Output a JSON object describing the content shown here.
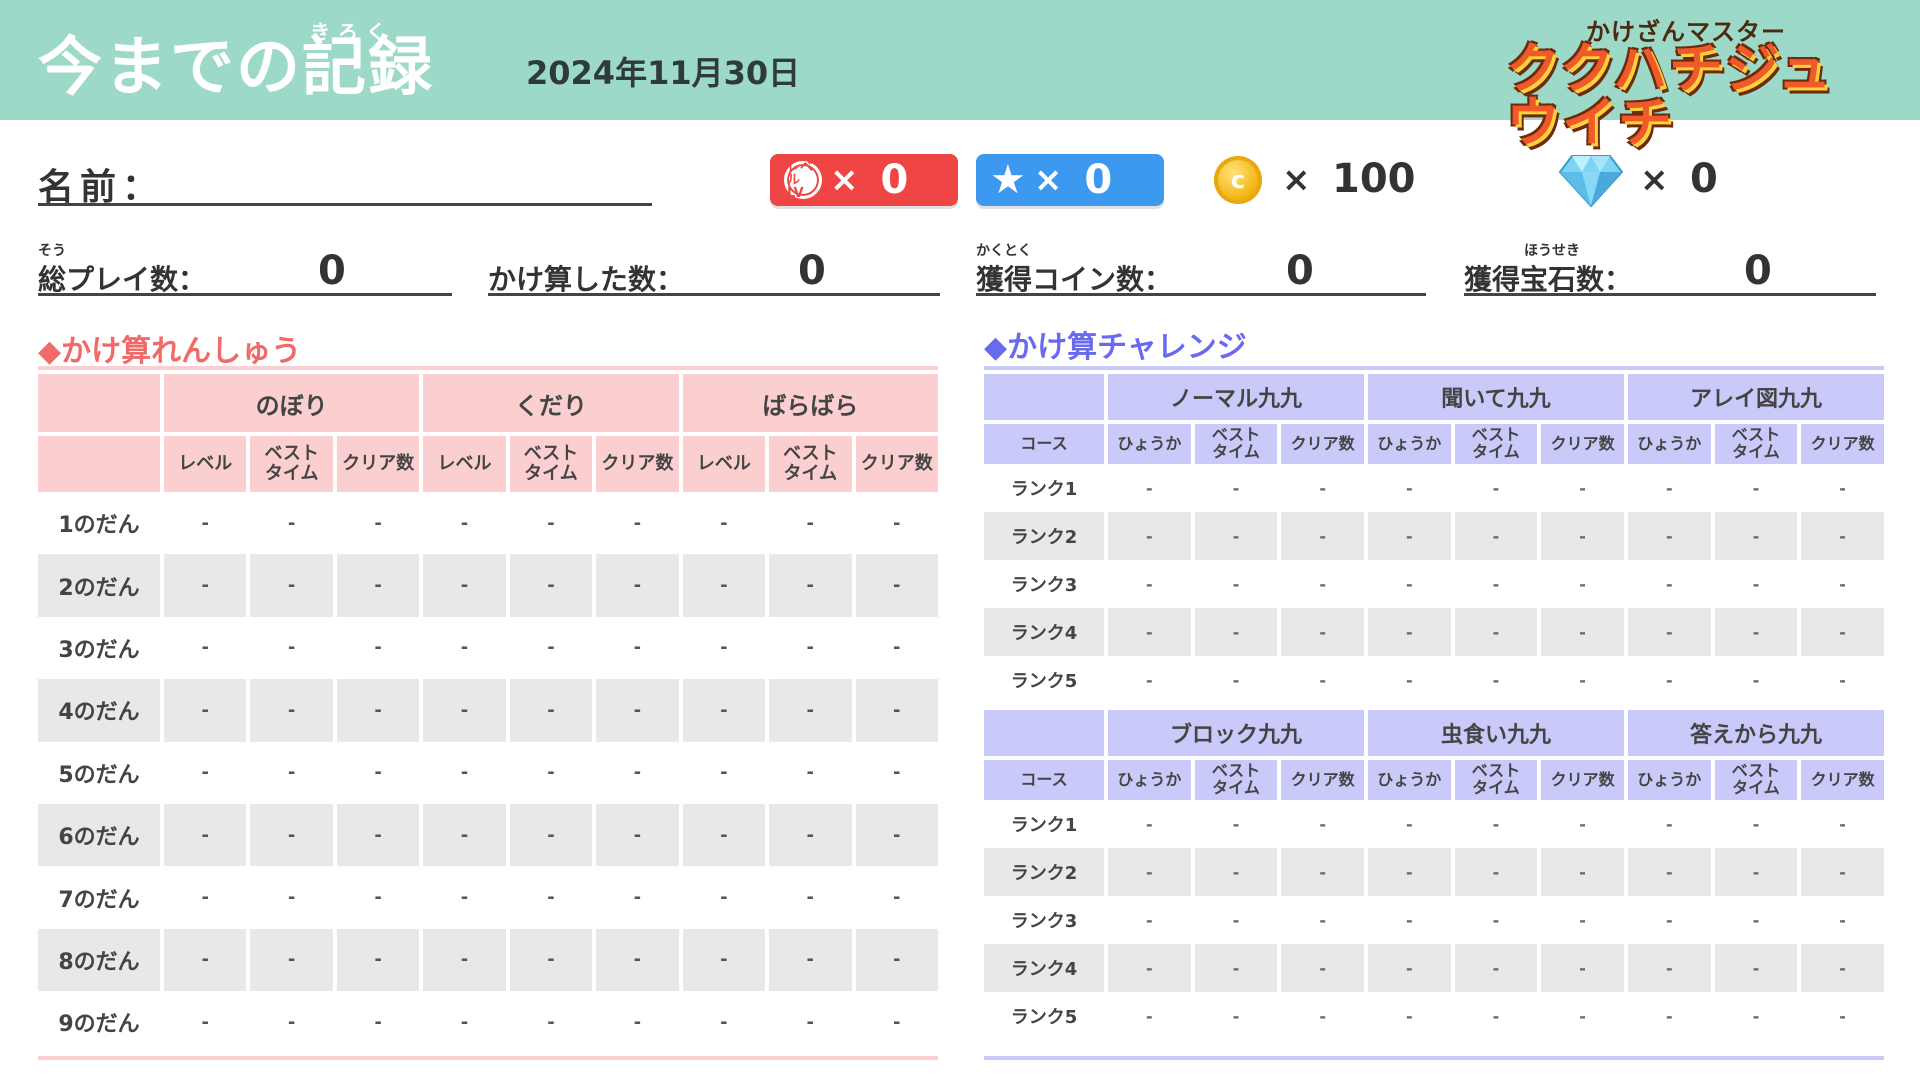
{
  "header": {
    "title_ruby": "きろく",
    "title": "今までの記録",
    "date": "2024年11月30日",
    "logo_sub": "かけざんマスター",
    "logo_main": "ククハチジュウイチ"
  },
  "profile": {
    "name_label": "名前：",
    "level_badge": "レベル LV",
    "level_count": "0",
    "star_count": "0",
    "coin_count": "100",
    "gem_count": "0",
    "times": "×"
  },
  "stats": [
    {
      "ruby": "そう",
      "label": "総プレイ数：",
      "value": "0"
    },
    {
      "ruby": "",
      "label": "かけ算した数：",
      "value": "0"
    },
    {
      "ruby": "かくとく",
      "label": "獲得コイン数：",
      "value": "0"
    },
    {
      "ruby": "ほうせき",
      "label": "獲得宝石数：",
      "value": "0"
    }
  ],
  "practice": {
    "title": "◆かけ算れんしゅう",
    "groups": [
      "のぼり",
      "くだり",
      "ばらばら"
    ],
    "subheaders": [
      "レベル",
      "ベスト\nタイム",
      "クリア数"
    ],
    "rows": [
      {
        "label": "1のだん",
        "values": [
          "-",
          "-",
          "-",
          "-",
          "-",
          "-",
          "-",
          "-",
          "-"
        ]
      },
      {
        "label": "2のだん",
        "values": [
          "-",
          "-",
          "-",
          "-",
          "-",
          "-",
          "-",
          "-",
          "-"
        ]
      },
      {
        "label": "3のだん",
        "values": [
          "-",
          "-",
          "-",
          "-",
          "-",
          "-",
          "-",
          "-",
          "-"
        ]
      },
      {
        "label": "4のだん",
        "values": [
          "-",
          "-",
          "-",
          "-",
          "-",
          "-",
          "-",
          "-",
          "-"
        ]
      },
      {
        "label": "5のだん",
        "values": [
          "-",
          "-",
          "-",
          "-",
          "-",
          "-",
          "-",
          "-",
          "-"
        ]
      },
      {
        "label": "6のだん",
        "values": [
          "-",
          "-",
          "-",
          "-",
          "-",
          "-",
          "-",
          "-",
          "-"
        ]
      },
      {
        "label": "7のだん",
        "values": [
          "-",
          "-",
          "-",
          "-",
          "-",
          "-",
          "-",
          "-",
          "-"
        ]
      },
      {
        "label": "8のだん",
        "values": [
          "-",
          "-",
          "-",
          "-",
          "-",
          "-",
          "-",
          "-",
          "-"
        ]
      },
      {
        "label": "9のだん",
        "values": [
          "-",
          "-",
          "-",
          "-",
          "-",
          "-",
          "-",
          "-",
          "-"
        ]
      }
    ]
  },
  "challenge": {
    "title": "◆かけ算チャレンジ",
    "course_label": "コース",
    "subheaders": [
      "ひょうか",
      "ベスト\nタイム",
      "クリア数"
    ],
    "blocks": [
      {
        "groups": [
          "ノーマル九九",
          "聞いて九九",
          "アレイ図九九"
        ],
        "rows": [
          {
            "label": "ランク1",
            "values": [
              "-",
              "-",
              "-",
              "-",
              "-",
              "-",
              "-",
              "-",
              "-"
            ]
          },
          {
            "label": "ランク2",
            "values": [
              "-",
              "-",
              "-",
              "-",
              "-",
              "-",
              "-",
              "-",
              "-"
            ]
          },
          {
            "label": "ランク3",
            "values": [
              "-",
              "-",
              "-",
              "-",
              "-",
              "-",
              "-",
              "-",
              "-"
            ]
          },
          {
            "label": "ランク4",
            "values": [
              "-",
              "-",
              "-",
              "-",
              "-",
              "-",
              "-",
              "-",
              "-"
            ]
          },
          {
            "label": "ランク5",
            "values": [
              "-",
              "-",
              "-",
              "-",
              "-",
              "-",
              "-",
              "-",
              "-"
            ]
          }
        ]
      },
      {
        "groups": [
          "ブロック九九",
          "虫食い九九",
          "答えから九九"
        ],
        "rows": [
          {
            "label": "ランク1",
            "values": [
              "-",
              "-",
              "-",
              "-",
              "-",
              "-",
              "-",
              "-",
              "-"
            ]
          },
          {
            "label": "ランク2",
            "values": [
              "-",
              "-",
              "-",
              "-",
              "-",
              "-",
              "-",
              "-",
              "-"
            ]
          },
          {
            "label": "ランク3",
            "values": [
              "-",
              "-",
              "-",
              "-",
              "-",
              "-",
              "-",
              "-",
              "-"
            ]
          },
          {
            "label": "ランク4",
            "values": [
              "-",
              "-",
              "-",
              "-",
              "-",
              "-",
              "-",
              "-",
              "-"
            ]
          },
          {
            "label": "ランク5",
            "values": [
              "-",
              "-",
              "-",
              "-",
              "-",
              "-",
              "-",
              "-",
              "-"
            ]
          }
        ]
      }
    ]
  },
  "colors": {
    "header_bg": "#9dd9c8",
    "practice_accent": "#f06a6a",
    "practice_header": "#fbcfd0",
    "challenge_accent": "#6a6af0",
    "challenge_header": "#c9c9fa",
    "level_pill": "#ef4545",
    "star_pill": "#3d98f0"
  }
}
